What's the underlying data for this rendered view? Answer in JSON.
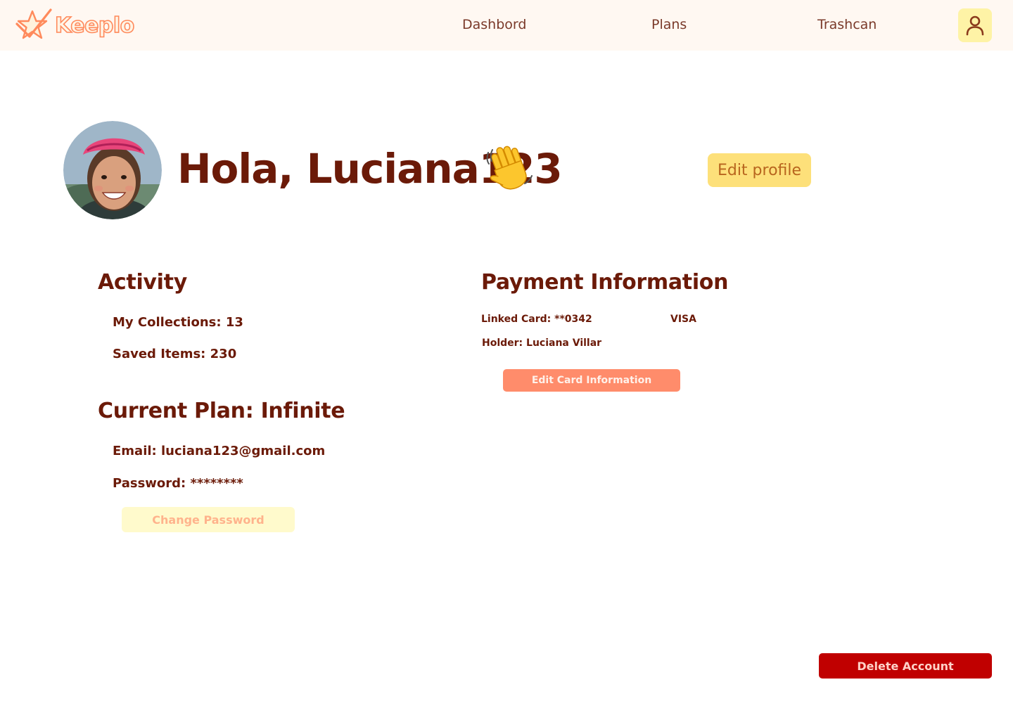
{
  "header": {
    "logo_text": "Keeplo",
    "nav": [
      {
        "label": "Dashbord"
      },
      {
        "label": "Plans"
      },
      {
        "label": "Trashcan"
      }
    ],
    "profile_icon": "user-icon"
  },
  "hero": {
    "greeting": "Hola, Luciana123",
    "wave_icon": "waving-hand-emoji",
    "edit_profile_label": "Edit profile"
  },
  "activity": {
    "title": "Activity",
    "collections": "My Collections: 13",
    "saved_items": "Saved Items: 230"
  },
  "plan": {
    "title": "Current Plan: Infinite",
    "email": "Email: luciana123@gmail.com",
    "password": "Password: ********",
    "change_password_label": "Change Password"
  },
  "payment": {
    "title": "Payment Information",
    "linked_card": "Linked Card: **0342",
    "card_brand": "VISA",
    "holder": "Holder: Luciana Villar",
    "edit_card_label": "Edit Card Information"
  },
  "account": {
    "delete_label": "Delete Account"
  },
  "colors": {
    "header_bg": "#fff8f2",
    "text_primary": "#6b1a08",
    "edit_profile_bg": "#fde07a",
    "change_password_bg": "#fffacc",
    "edit_card_bg": "#ff8c6b",
    "delete_bg": "#c00000"
  }
}
